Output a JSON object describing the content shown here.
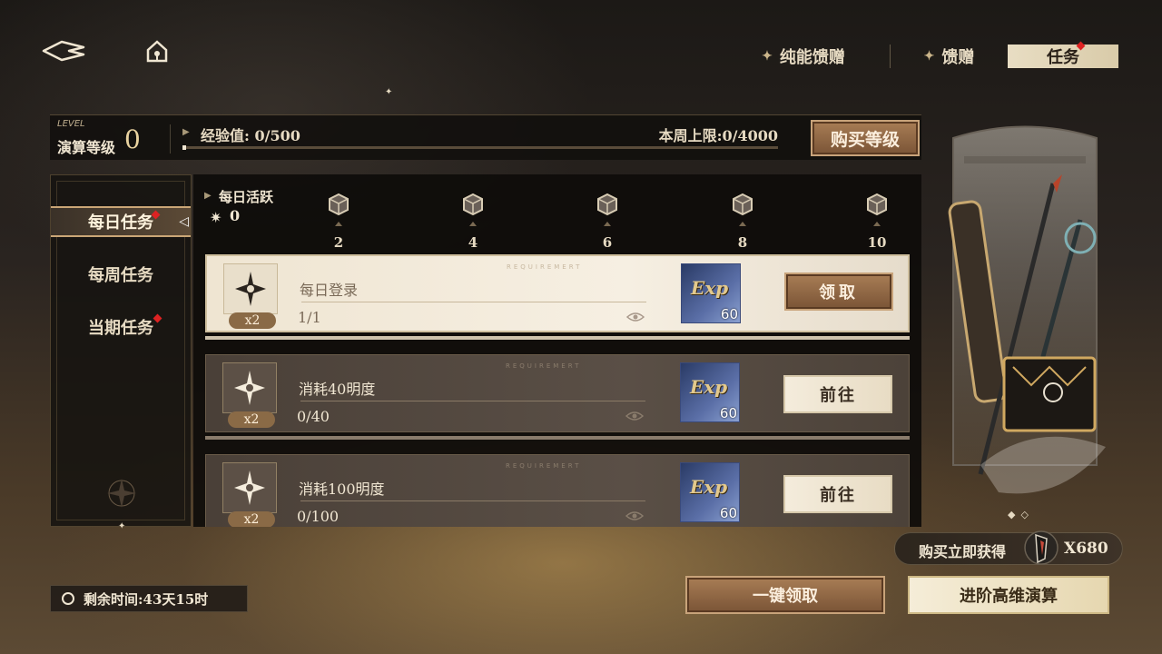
{
  "top_tabs": {
    "tab1": "纯能馈赠",
    "tab2": "馈赠",
    "tab3": "任务"
  },
  "level": {
    "small_label": "LEVEL",
    "label": "演算等级",
    "value": "0",
    "exp_label": "经验值: 0/500",
    "exp_progress": 0.0,
    "week_limit": "本周上限:0/4000",
    "buy_button": "购买等级"
  },
  "sidebar": {
    "items": [
      {
        "label": "每日任务",
        "active": true,
        "badge": true
      },
      {
        "label": "每周任务",
        "active": false,
        "badge": false
      },
      {
        "label": "当期任务",
        "active": false,
        "badge": true
      }
    ]
  },
  "activity": {
    "title": "每日活跃",
    "value": "0",
    "milestones": [
      "2",
      "4",
      "6",
      "8",
      "10"
    ]
  },
  "tasks": [
    {
      "name": "每日登录",
      "progress": "1/1",
      "multiplier": "x2",
      "requirement": "REQUIREMERT",
      "reward_label": "Exp",
      "reward_qty": "60",
      "button": "领取",
      "state": "claimable"
    },
    {
      "name": "消耗40明度",
      "progress": "0/40",
      "multiplier": "x2",
      "requirement": "REQUIREMERT",
      "reward_label": "Exp",
      "reward_qty": "60",
      "button": "前往",
      "state": "goto"
    },
    {
      "name": "消耗100明度",
      "progress": "0/100",
      "multiplier": "x2",
      "requirement": "REQUIREMERT",
      "reward_label": "Exp",
      "reward_qty": "60",
      "button": "前往",
      "state": "goto"
    }
  ],
  "promo": {
    "buy_get_text": "购买立即获得",
    "buy_get_qty": "X680"
  },
  "bottom": {
    "remaining_time": "剩余时间:43天15时",
    "claim_all": "一键领取",
    "advance": "进阶高维演算"
  },
  "colors": {
    "accent_brown": "#8a6242",
    "gold": "#e9d3a0",
    "badge_red": "#dd2222"
  }
}
